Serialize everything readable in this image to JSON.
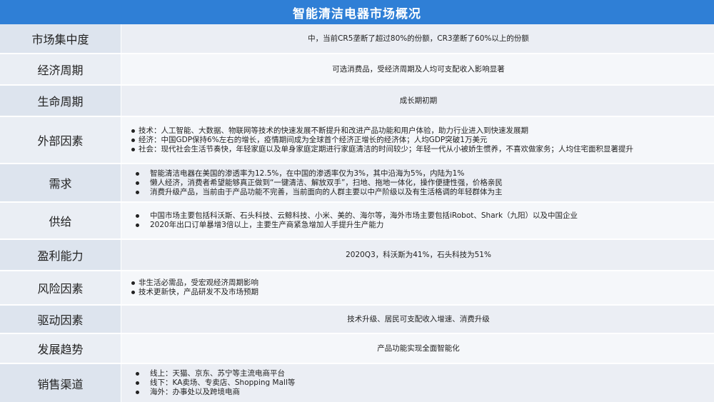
{
  "title": "智能清洁电器市场概况",
  "rows": [
    {
      "label": "市场集中度",
      "text": "中，当前CR5垄断了超过80%的份额，CR3垄断了60%以上的份额"
    },
    {
      "label": "经济周期",
      "text": "可选消费品，受经济周期及人均可支配收入影响显著"
    },
    {
      "label": "生命周期",
      "text": "成长期初期"
    },
    {
      "label": "外部因素",
      "items": [
        "技术：人工智能、大数据、物联网等技术的快速发展不断提升和改进产品功能和用户体验，助力行业进入到快速发展期",
        "经济：中国GDP保持6%左右的增长，疫情期间成为全球首个经济正增长的经济体；人均GDP突破1万美元",
        "社会：现代社会生活节奏快，年轻家庭以及单身家庭定期进行家庭清洁的时间较少；年轻一代从小被娇生惯养，不喜欢做家务；人均住宅面积显著提升"
      ]
    },
    {
      "label": "需求",
      "items": [
        "智能清洁电器在美国的渗透率为12.5%，在中国的渗透率仅为3%，其中沿海为5%，内陆为1%",
        "懒人经济，消费者希望能够真正做到“一键清洁、解放双手”，扫地、拖地一体化，操作便捷性强，价格亲民",
        "消费升级产品，当前由于产品功能不完善，当前面向的人群主要以中产阶级以及有生活格调的年轻群体为主"
      ]
    },
    {
      "label": "供给",
      "items": [
        "中国市场主要包括科沃斯、石头科技、云鲸科技、小米、美的、海尔等，海外市场主要包括iRobot、Shark（九阳）以及中国企业",
        "2020年出口订单暴增3倍以上，主要生产商紧急增加人手提升生产能力"
      ]
    },
    {
      "label": "盈利能力",
      "text": "2020Q3，科沃斯为41%，石头科技为51%"
    },
    {
      "label": "风险因素",
      "items": [
        "非生活必需品，受宏观经济周期影响",
        "技术更新快，产品研发不及市场预期"
      ]
    },
    {
      "label": "驱动因素",
      "text": "技术升级、居民可支配收入增速、消费升级"
    },
    {
      "label": "发展趋势",
      "text": "产品功能实现全面智能化"
    },
    {
      "label": "销售渠道",
      "items": [
        "线上：天猫、京东、苏宁等主流电商平台",
        "线下：KA卖场、专卖店、Shopping Mall等",
        "海外：办事处以及跨境电商"
      ]
    }
  ]
}
